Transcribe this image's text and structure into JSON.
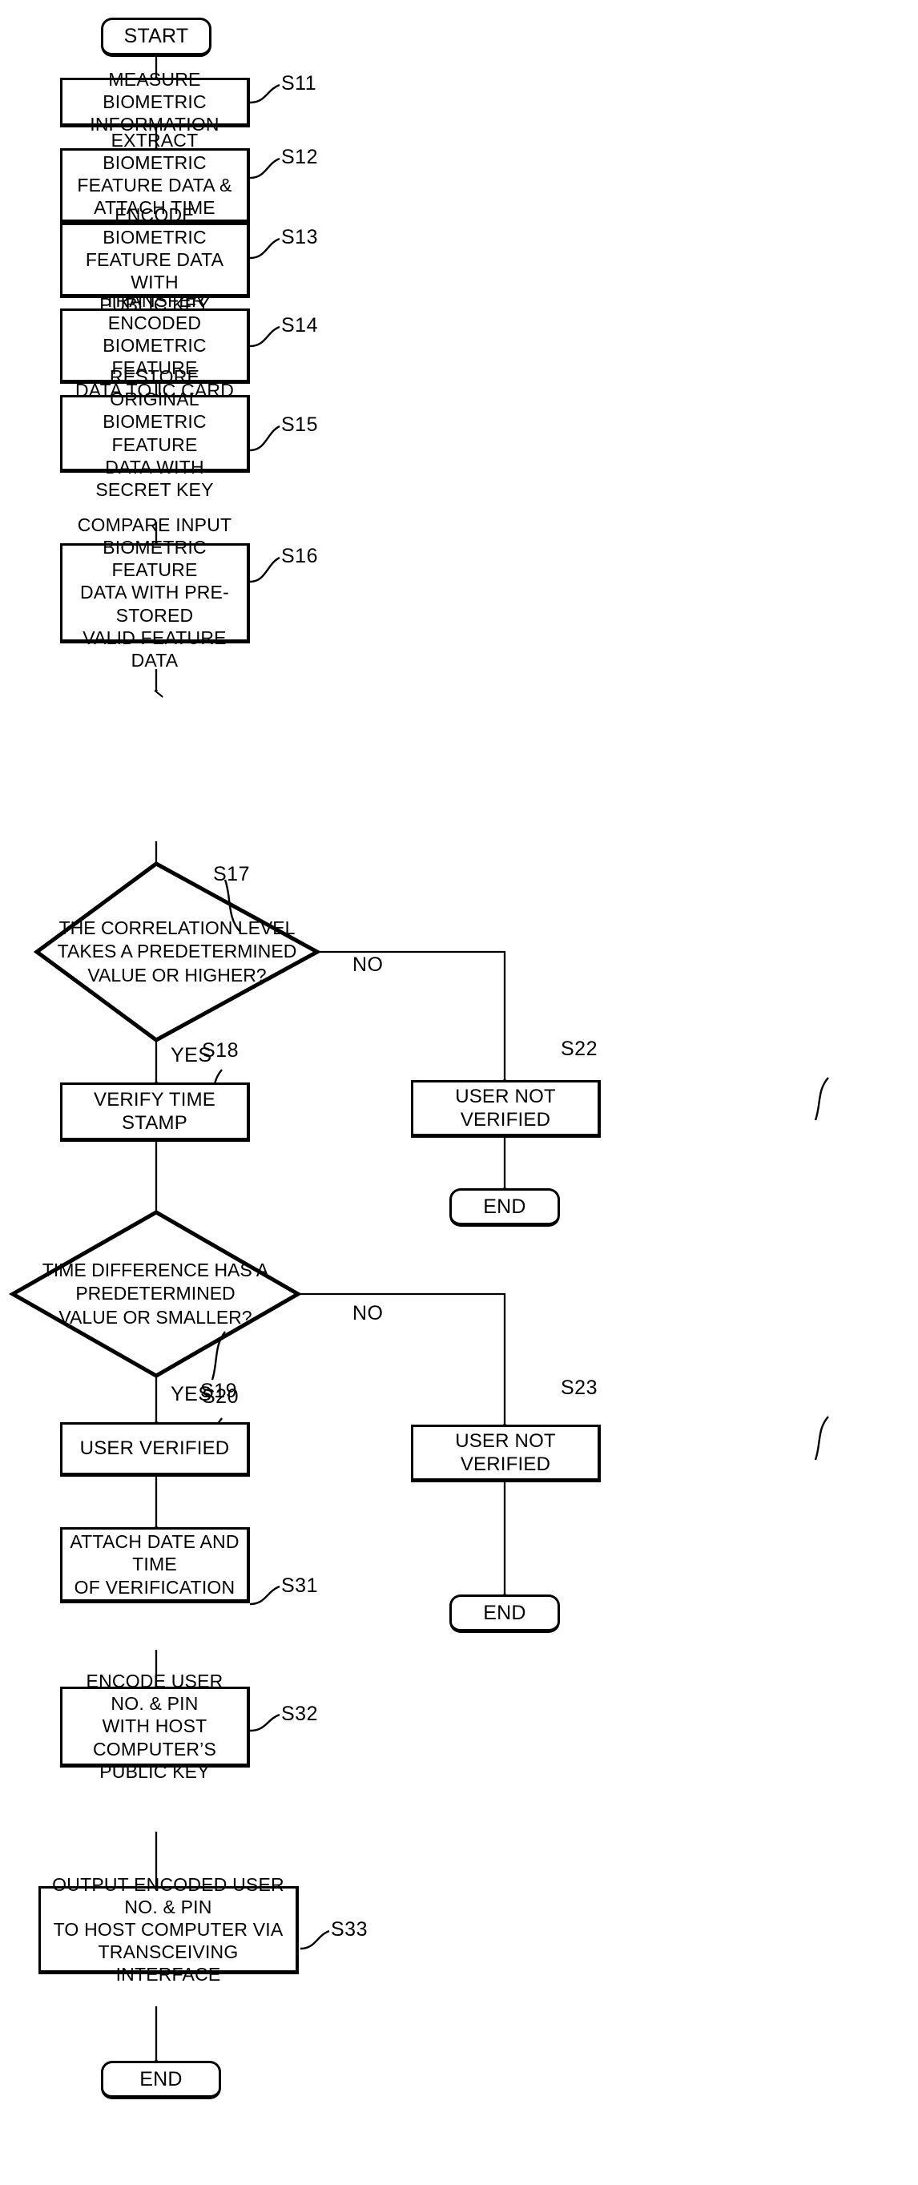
{
  "diagram": {
    "type": "flowchart",
    "title": "Biometric user verification process flowchart",
    "orientation": "vertical",
    "colors": {
      "stroke": "#000000",
      "fill": "#ffffff",
      "text": "#000000"
    }
  },
  "nodes": {
    "start": {
      "label": "START",
      "shape": "terminator",
      "step": ""
    },
    "s11": {
      "label": "MEASURE BIOMETRIC\nINFORMATION",
      "shape": "process",
      "step": "S11"
    },
    "s12": {
      "label": "EXTRACT BIOMETRIC\nFEATURE DATA &\nATTACH TIME STAMP",
      "shape": "process",
      "step": "S12"
    },
    "s13": {
      "label": "ENCODE BIOMETRIC\nFEATURE DATA WITH\nPUBLIC KEY",
      "shape": "process",
      "step": "S13"
    },
    "s14": {
      "label": "TRANSFER ENCODED\nBIOMETRIC FEATURE\nDATA TO IC CARD",
      "shape": "process",
      "step": "S14"
    },
    "s15": {
      "label": "RESTORE ORIGINAL\nBIOMETRIC FEATURE\nDATA WITH SECRET KEY",
      "shape": "process",
      "step": "S15"
    },
    "s16": {
      "label": "COMPARE INPUT\nBIOMETRIC FEATURE\nDATA WITH PRE-STORED\nVALID FEATURE DATA",
      "shape": "process",
      "step": "S16"
    },
    "s17": {
      "label": "THE CORRELATION LEVEL\nTAKES A PREDETERMINED\nVALUE OR HIGHER?",
      "shape": "decision",
      "step": "S17"
    },
    "s18": {
      "label": "VERIFY TIME STAMP",
      "shape": "process",
      "step": "S18"
    },
    "s19": {
      "label": "TIME DIFFERENCE HAS A\nPREDETERMINED\nVALUE OR SMALLER?",
      "shape": "decision",
      "step": "S19"
    },
    "s20": {
      "label": "USER VERIFIED",
      "shape": "process",
      "step": "S20"
    },
    "s22": {
      "label": "USER NOT VERIFIED",
      "shape": "process",
      "step": "S22"
    },
    "s23": {
      "label": "USER NOT VERIFIED",
      "shape": "process",
      "step": "S23"
    },
    "s31": {
      "label": "ATTACH DATE AND TIME\nOF  VERIFICATION",
      "shape": "process",
      "step": "S31"
    },
    "s32": {
      "label": "ENCODE USER NO. & PIN\nWITH HOST COMPUTER’S\nPUBLIC KEY",
      "shape": "process",
      "step": "S32"
    },
    "s33": {
      "label": "OUTPUT ENCODED USER NO. & PIN\nTO HOST COMPUTER VIA\nTRANSCEIVING INTERFACE",
      "shape": "process",
      "step": "S33"
    },
    "end_s22": {
      "label": "END",
      "shape": "terminator",
      "step": ""
    },
    "end_s23": {
      "label": "END",
      "shape": "terminator",
      "step": ""
    },
    "end_main": {
      "label": "END",
      "shape": "terminator",
      "step": ""
    }
  },
  "branches": {
    "s17_no": "NO",
    "s17_yes": "YES",
    "s19_no": "NO",
    "s19_yes": "YES"
  },
  "edges": [
    {
      "from": "start",
      "to": "s11",
      "label": ""
    },
    {
      "from": "s11",
      "to": "s12",
      "label": ""
    },
    {
      "from": "s12",
      "to": "s13",
      "label": ""
    },
    {
      "from": "s13",
      "to": "s14",
      "label": ""
    },
    {
      "from": "s14",
      "to": "s15",
      "label": ""
    },
    {
      "from": "s15",
      "to": "s16",
      "label": ""
    },
    {
      "from": "s16",
      "to": "s17",
      "label": ""
    },
    {
      "from": "s17",
      "to": "s18",
      "label": "YES"
    },
    {
      "from": "s17",
      "to": "s22",
      "label": "NO"
    },
    {
      "from": "s18",
      "to": "s19",
      "label": ""
    },
    {
      "from": "s19",
      "to": "s20",
      "label": "YES"
    },
    {
      "from": "s19",
      "to": "s23",
      "label": "NO"
    },
    {
      "from": "s22",
      "to": "end_s22",
      "label": ""
    },
    {
      "from": "s23",
      "to": "end_s23",
      "label": ""
    },
    {
      "from": "s20",
      "to": "s31",
      "label": ""
    },
    {
      "from": "s31",
      "to": "s32",
      "label": ""
    },
    {
      "from": "s32",
      "to": "s33",
      "label": ""
    },
    {
      "from": "s33",
      "to": "end_main",
      "label": ""
    }
  ]
}
